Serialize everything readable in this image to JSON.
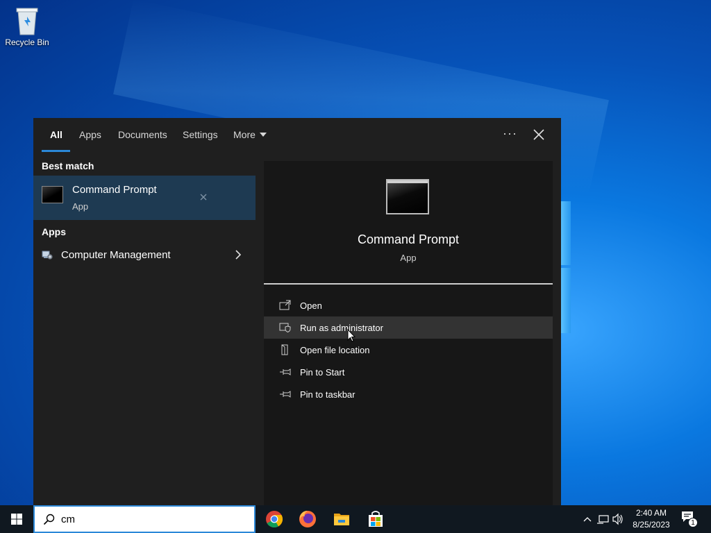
{
  "desktop": {
    "recycle_bin_label": "Recycle Bin"
  },
  "search_panel": {
    "tabs": [
      {
        "label": "All",
        "active": true
      },
      {
        "label": "Apps"
      },
      {
        "label": "Documents"
      },
      {
        "label": "Settings"
      },
      {
        "label": "More"
      }
    ],
    "more_options": "···",
    "best_match_heading": "Best match",
    "best_match": {
      "title": "Command Prompt",
      "subtitle": "App",
      "icon": "cmd-icon"
    },
    "apps_heading": "Apps",
    "apps": [
      {
        "name": "Computer Management",
        "icon": "computer-management-icon"
      }
    ],
    "preview": {
      "title": "Command Prompt",
      "subtitle": "App",
      "actions": [
        {
          "label": "Open",
          "icon": "open-icon"
        },
        {
          "label": "Run as administrator",
          "icon": "shield-icon",
          "hovered": true
        },
        {
          "label": "Open file location",
          "icon": "file-location-icon"
        },
        {
          "label": "Pin to Start",
          "icon": "pin-icon"
        },
        {
          "label": "Pin to taskbar",
          "icon": "pin-icon"
        }
      ]
    }
  },
  "taskbar": {
    "search_value": "cm",
    "apps": [
      "chrome-icon",
      "firefox-icon",
      "file-explorer-icon",
      "store-icon"
    ],
    "clock_time": "2:40 AM",
    "clock_date": "8/25/2023",
    "notification_count": "1"
  },
  "colors": {
    "accent": "#2b88d8",
    "panel_bg": "#1f1f1f",
    "best_match_bg": "#1e3a52"
  }
}
